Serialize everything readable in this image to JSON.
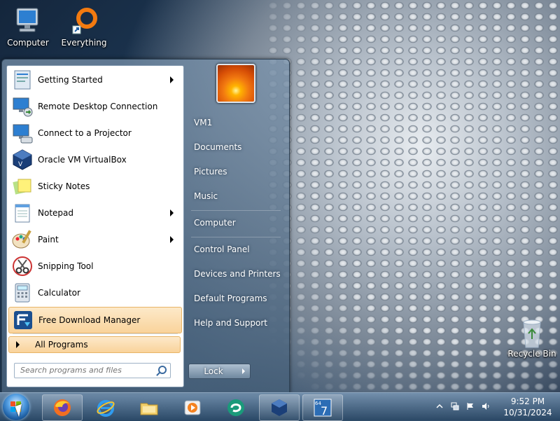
{
  "desktop": {
    "icons": [
      {
        "label": "Computer"
      },
      {
        "label": "Everything"
      },
      {
        "label": "Recycle Bin"
      }
    ]
  },
  "start_menu": {
    "programs": [
      {
        "label": "Getting Started",
        "has_submenu": true
      },
      {
        "label": "Remote Desktop Connection",
        "has_submenu": false
      },
      {
        "label": "Connect to a Projector",
        "has_submenu": false
      },
      {
        "label": "Oracle VM VirtualBox",
        "has_submenu": false
      },
      {
        "label": "Sticky Notes",
        "has_submenu": false
      },
      {
        "label": "Notepad",
        "has_submenu": true
      },
      {
        "label": "Paint",
        "has_submenu": true
      },
      {
        "label": "Snipping Tool",
        "has_submenu": false
      },
      {
        "label": "Calculator",
        "has_submenu": false
      },
      {
        "label": "Free Download Manager",
        "has_submenu": false,
        "highlighted": true
      }
    ],
    "all_programs_label": "All Programs",
    "search_placeholder": "Search programs and files",
    "right_links": [
      {
        "label": "VM1"
      },
      {
        "label": "Documents"
      },
      {
        "label": "Pictures"
      },
      {
        "label": "Music"
      },
      {
        "label": "Computer"
      },
      {
        "label": "Control Panel"
      },
      {
        "label": "Devices and Printers"
      },
      {
        "label": "Default Programs"
      },
      {
        "label": "Help and Support"
      }
    ],
    "lock_label": "Lock"
  },
  "taskbar": {
    "pinned": [
      "firefox-icon",
      "internet-explorer-icon",
      "windows-explorer-icon",
      "media-player-icon",
      "app-icon",
      "virtualbox-icon",
      "seven-badge-icon"
    ],
    "clock": {
      "time": "9:52 PM",
      "date": "10/31/2024"
    }
  }
}
